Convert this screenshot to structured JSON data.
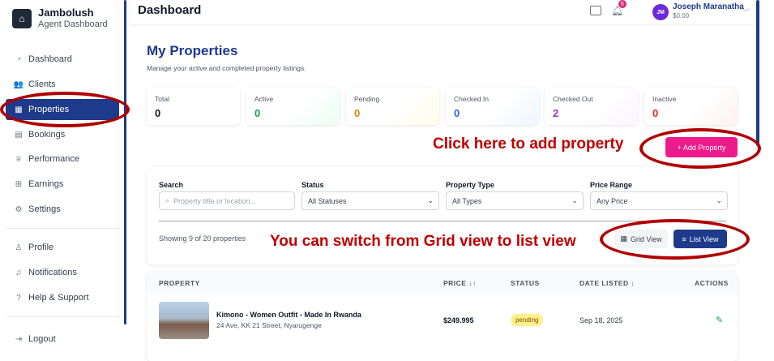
{
  "brand": {
    "name": "Jambolush",
    "subtitle": "Agent Dashboard"
  },
  "sidebar": {
    "items": [
      {
        "label": "Dashboard",
        "icon": "dashboard-icon"
      },
      {
        "label": "Clients",
        "icon": "clients-icon"
      },
      {
        "label": "Properties",
        "icon": "building-icon",
        "active": true
      },
      {
        "label": "Bookings",
        "icon": "calendar-icon"
      },
      {
        "label": "Performance",
        "icon": "trophy-icon"
      },
      {
        "label": "Earnings",
        "icon": "earnings-icon"
      },
      {
        "label": "Settings",
        "icon": "gear-icon"
      },
      {
        "label": "Profile",
        "icon": "user-icon"
      },
      {
        "label": "Notifications",
        "icon": "bell-icon"
      },
      {
        "label": "Help & Support",
        "icon": "help-icon"
      },
      {
        "label": "Logout",
        "icon": "logout-icon"
      }
    ]
  },
  "header": {
    "title": "Dashboard",
    "notification_count": "6",
    "user": {
      "initials": "JM",
      "name": "Joseph Maranatha",
      "balance": "$0.00"
    }
  },
  "page": {
    "title": "My Properties",
    "subtitle": "Manage your active and completed property listings."
  },
  "stats": [
    {
      "label": "Total",
      "value": "0",
      "color": "#111827"
    },
    {
      "label": "Active",
      "value": "0",
      "color": "#16a34a"
    },
    {
      "label": "Pending",
      "value": "0",
      "color": "#ca8a04"
    },
    {
      "label": "Checked In",
      "value": "0",
      "color": "#2563eb"
    },
    {
      "label": "Checked Out",
      "value": "2",
      "color": "#9333ea"
    },
    {
      "label": "Inactive",
      "value": "0",
      "color": "#dc2626"
    }
  ],
  "annotations": {
    "add_hint": "Click here to add property",
    "view_hint": "You can switch from Grid view to list view"
  },
  "actions": {
    "add_property": "+ Add Property"
  },
  "filters": {
    "search_label": "Search",
    "search_placeholder": "Property title or location...",
    "status_label": "Status",
    "status_value": "All Statuses",
    "type_label": "Property Type",
    "type_value": "All Types",
    "price_label": "Price Range",
    "price_value": "Any Price",
    "showing": "Showing 9 of 20 properties",
    "grid_view": "Grid View",
    "list_view": "List View"
  },
  "table": {
    "headers": [
      "PROPERTY",
      "PRICE ↓↑",
      "STATUS",
      "DATE LISTED ↓",
      "ACTIONS"
    ],
    "rows": [
      {
        "name": "Kimono - Women Outfit - Made In Rwanda",
        "address": "24 Ave, KK 21 Street, Nyarugenge",
        "price": "$249.995",
        "status": "pending",
        "date": "Sep 18, 2025"
      }
    ]
  }
}
